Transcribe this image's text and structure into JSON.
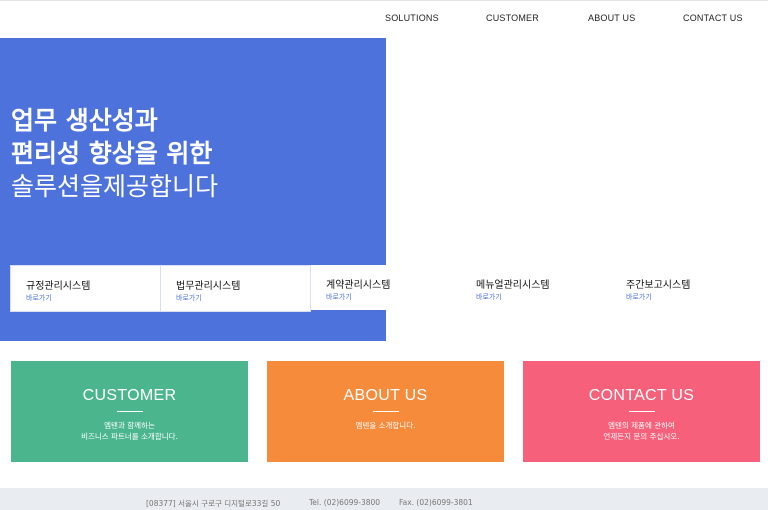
{
  "nav": {
    "items": [
      "SOLUTIONS",
      "CUSTOMER",
      "ABOUT US",
      "CONTACT US"
    ]
  },
  "hero": {
    "line1": "업무 생산성과",
    "line2": "편리성 향상을 위한",
    "line3": "솔루션을제공합니다",
    "background": "#4d72dc"
  },
  "systems": [
    {
      "name": "규정관리시스템",
      "link": "바로가기"
    },
    {
      "name": "법무관리시스템",
      "link": "바로가기"
    },
    {
      "name": "계약관리시스템",
      "link": "바로가기"
    },
    {
      "name": "메뉴얼관리시스템",
      "link": "바로가기"
    },
    {
      "name": "주간보고시스템",
      "link": "바로가기"
    }
  ],
  "features": [
    {
      "title": "CUSTOMER",
      "desc1": "엠텐과 함께하는",
      "desc2": "비즈니스 파트너를 소개합니다.",
      "color": "#4bb58e"
    },
    {
      "title": "ABOUT US",
      "desc1": "엠텐을 소개합니다.",
      "desc2": "",
      "color": "#f68b3c"
    },
    {
      "title": "CONTACT US",
      "desc1": "엠텐의 제품에 관하여",
      "desc2": "언제든지 문의 주십시오.",
      "color": "#f6607a"
    }
  ],
  "footer": {
    "address": "[08377] 서울시 구로구 디지털로33길 50",
    "tel": "Tel. (02)6099-3800",
    "fax": "Fax. (02)6099-3801"
  }
}
